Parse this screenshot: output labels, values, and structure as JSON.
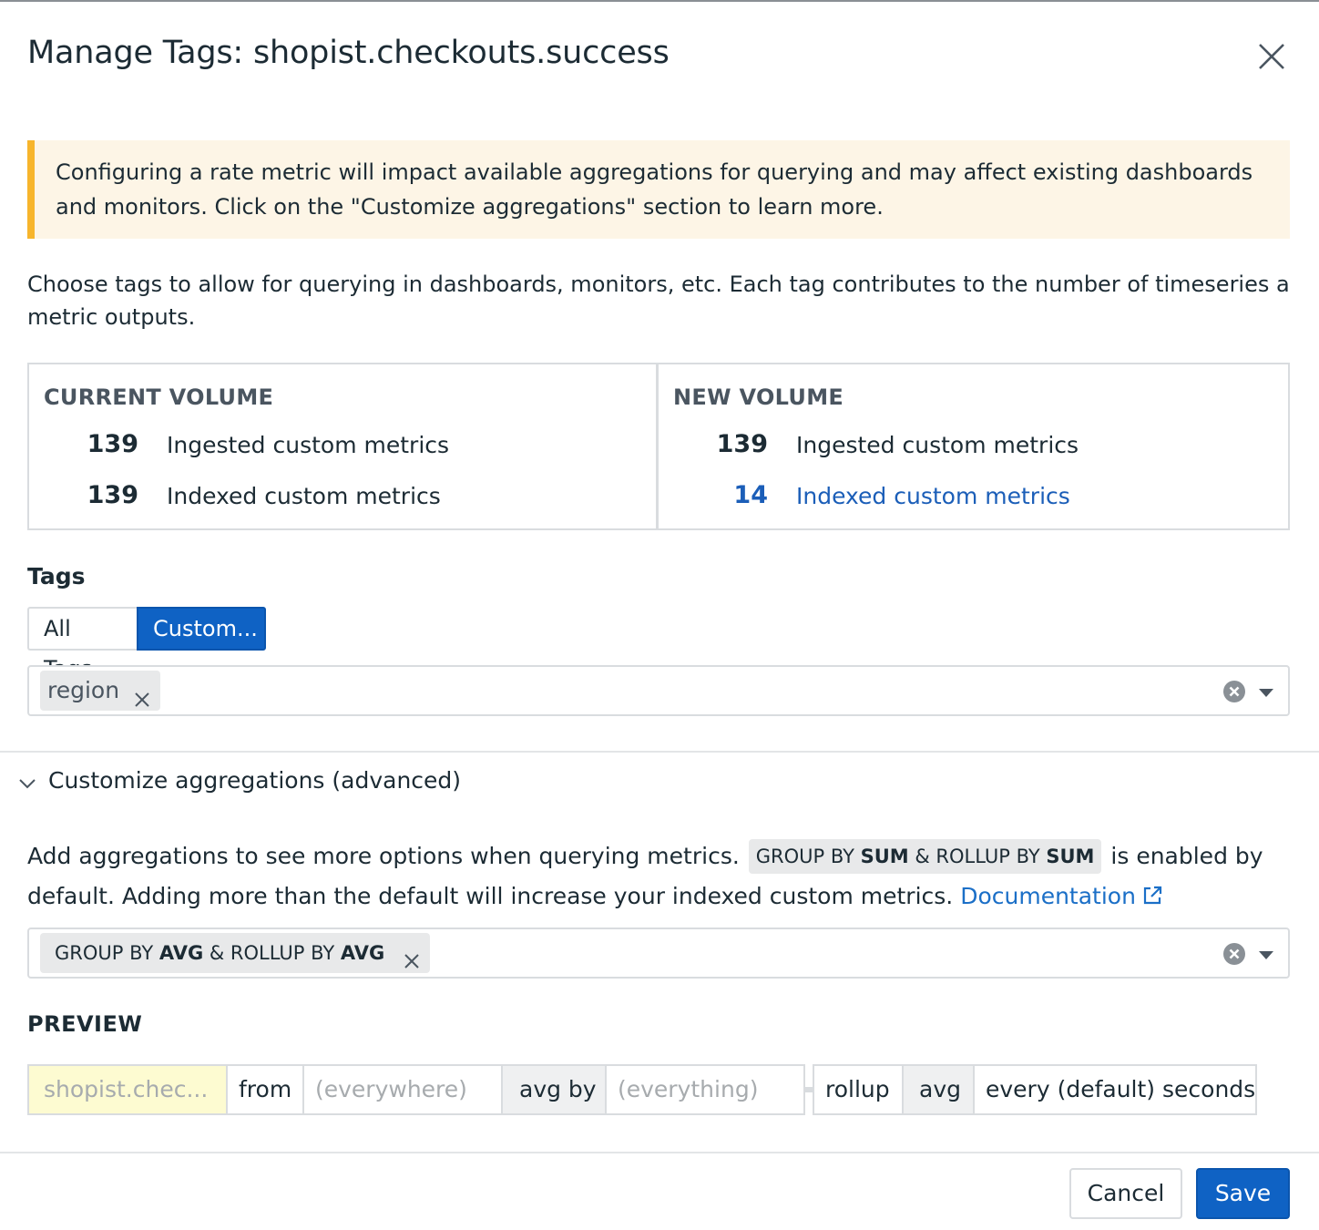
{
  "dialog": {
    "title": "Manage Tags: shopist.checkouts.success"
  },
  "warning": {
    "text": "Configuring a rate metric will impact available aggregations for querying and may affect existing dashboards and monitors. Click on the \"Customize aggregations\" section to learn more.",
    "accent_color": "#f7b52c"
  },
  "description": "Choose tags to allow for querying in dashboards, monitors, etc. Each tag contributes to the number of timeseries a metric outputs.",
  "volume": {
    "current": {
      "heading": "CURRENT VOLUME",
      "ingested_value": "139",
      "ingested_label": "Ingested custom metrics",
      "indexed_value": "139",
      "indexed_label": "Indexed custom metrics"
    },
    "new": {
      "heading": "NEW VOLUME",
      "ingested_value": "139",
      "ingested_label": "Ingested custom metrics",
      "indexed_value": "14",
      "indexed_label": "Indexed custom metrics",
      "highlight_color": "#1b5eb8"
    }
  },
  "tags": {
    "label": "Tags",
    "mode_options": [
      "All Tags",
      "Custom..."
    ],
    "selected_mode": "Custom...",
    "selected_tags": [
      "region"
    ]
  },
  "aggregations": {
    "section_title": "Customize aggregations (advanced)",
    "desc_prefix": "Add aggregations to see more options when querying metrics.",
    "default_chip": {
      "group_prefix": "GROUP BY ",
      "group_value": "SUM",
      "joiner": " & ROLLUP BY ",
      "rollup_value": "SUM"
    },
    "desc_suffix": "is enabled by default. Adding more than the default will increase your indexed custom metrics.",
    "doc_link": "Documentation",
    "selected": [
      {
        "group_prefix": "GROUP BY ",
        "group_value": "AVG",
        "joiner": " & ROLLUP BY ",
        "rollup_value": "AVG"
      }
    ]
  },
  "preview": {
    "label": "PREVIEW",
    "metric": "shopist.chec...",
    "from": "from",
    "where": "(everywhere)",
    "avg_by": "avg by",
    "everything": "(everything)",
    "rollup": "rollup",
    "rollup_fn": "avg",
    "interval": "every (default) seconds"
  },
  "footer": {
    "cancel": "Cancel",
    "save": "Save",
    "primary_color": "#0f62c4"
  },
  "icons": [
    "close-icon",
    "remove-tag-icon",
    "clear-icon",
    "caret-down-icon",
    "chevron-down-icon",
    "external-link-icon"
  ]
}
